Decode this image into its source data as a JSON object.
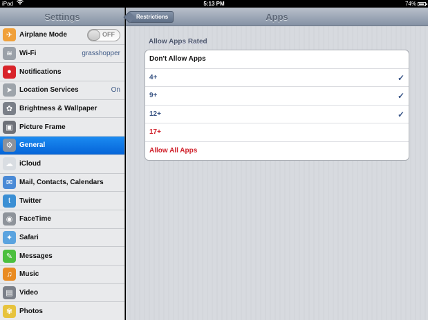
{
  "status": {
    "device": "iPad",
    "time": "5:13 PM",
    "battery": "74%",
    "battery_level": 0.74
  },
  "left": {
    "title": "Settings",
    "items": [
      {
        "label": "Airplane Mode",
        "icon": "airplane-icon",
        "icon_color": "#f0a03a",
        "glyph": "✈",
        "toggle": "OFF"
      },
      {
        "label": "Wi-Fi",
        "icon": "wifi-icon",
        "icon_color": "#9aa0a8",
        "glyph": "≋",
        "value": "grasshopper"
      },
      {
        "label": "Notifications",
        "icon": "notifications-icon",
        "icon_color": "#d8232a",
        "glyph": "●"
      },
      {
        "label": "Location Services",
        "icon": "location-icon",
        "icon_color": "#9ea4ab",
        "glyph": "➤",
        "value": "On"
      },
      {
        "label": "Brightness & Wallpaper",
        "icon": "brightness-icon",
        "icon_color": "#7a7f88",
        "glyph": "✿"
      },
      {
        "label": "Picture Frame",
        "icon": "picture-frame-icon",
        "icon_color": "#6d7078",
        "glyph": "▣"
      },
      {
        "label": "General",
        "icon": "gear-icon",
        "icon_color": "#8c929b",
        "glyph": "⚙",
        "selected": true
      },
      {
        "label": "iCloud",
        "icon": "cloud-icon",
        "icon_color": "#d9dde2",
        "glyph": "☁"
      },
      {
        "label": "Mail, Contacts, Calendars",
        "icon": "mail-icon",
        "icon_color": "#4a8ad6",
        "glyph": "✉"
      },
      {
        "label": "Twitter",
        "icon": "twitter-icon",
        "icon_color": "#3b8fd4",
        "glyph": "t"
      },
      {
        "label": "FaceTime",
        "icon": "facetime-icon",
        "icon_color": "#8e939a",
        "glyph": "◉"
      },
      {
        "label": "Safari",
        "icon": "safari-icon",
        "icon_color": "#5aa3df",
        "glyph": "✦"
      },
      {
        "label": "Messages",
        "icon": "messages-icon",
        "icon_color": "#4bbf3e",
        "glyph": "✎"
      },
      {
        "label": "Music",
        "icon": "music-icon",
        "icon_color": "#e98b22",
        "glyph": "♫"
      },
      {
        "label": "Video",
        "icon": "video-icon",
        "icon_color": "#7b8089",
        "glyph": "▤"
      },
      {
        "label": "Photos",
        "icon": "photos-icon",
        "icon_color": "#e7c33d",
        "glyph": "✾"
      }
    ]
  },
  "right": {
    "title": "Apps",
    "back": "Restrictions",
    "section": "Allow Apps Rated",
    "options": [
      {
        "label": "Don't Allow Apps",
        "color": "#111111",
        "checked": false
      },
      {
        "label": "4+",
        "color": "#3a5584",
        "checked": true
      },
      {
        "label": "9+",
        "color": "#3a5584",
        "checked": true
      },
      {
        "label": "12+",
        "color": "#3a5584",
        "checked": true
      },
      {
        "label": "17+",
        "color": "#d0202a",
        "checked": false
      },
      {
        "label": "Allow All Apps",
        "color": "#d0202a",
        "checked": false
      }
    ]
  }
}
